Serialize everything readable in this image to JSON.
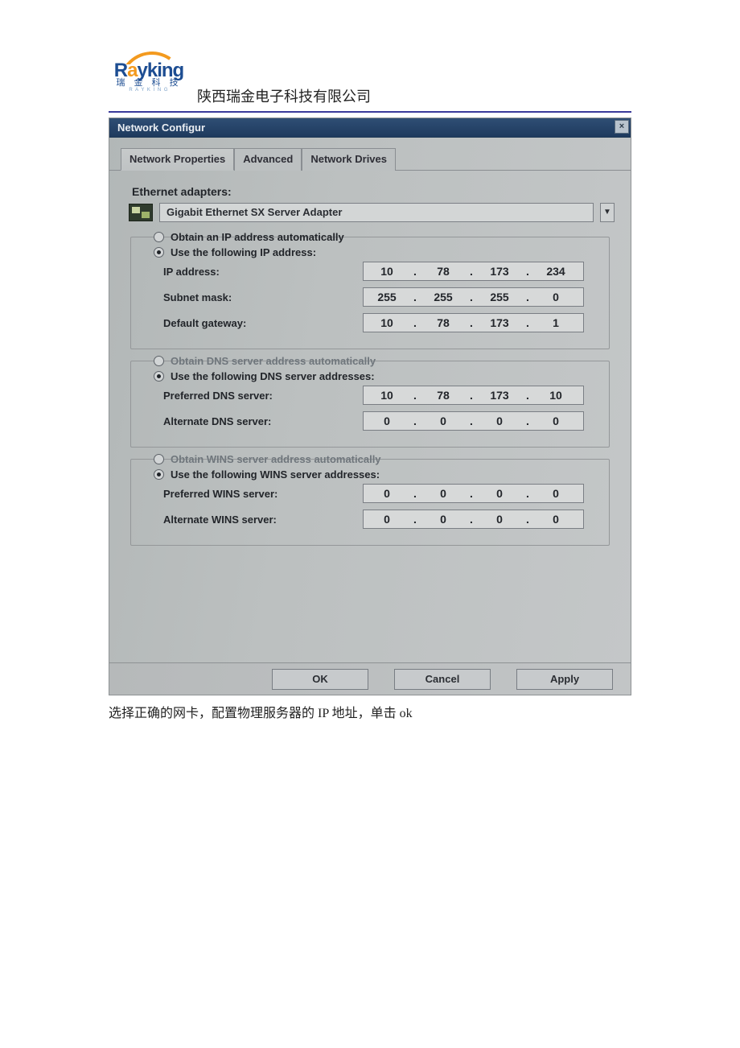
{
  "header": {
    "logo_main_a": "R",
    "logo_main_o": "a",
    "logo_main_b": "yking",
    "logo_sub": "瑞 金 科 技",
    "logo_tiny": "R A Y K I N G",
    "company": "陕西瑞金电子科技有限公司"
  },
  "dialog": {
    "title": "Network Configur",
    "tabs": [
      "Network Properties",
      "Advanced",
      "Network Drives"
    ],
    "adapters_label": "Ethernet adapters:",
    "adapter_selected": "Gigabit Ethernet SX Server Adapter",
    "ip_section": {
      "auto_label": "Obtain an IP address automatically",
      "manual_label": "Use the following IP address:",
      "selected": "manual",
      "fields": {
        "ip": {
          "label": "IP address:",
          "value": [
            "10",
            "78",
            "173",
            "234"
          ]
        },
        "mask": {
          "label": "Subnet mask:",
          "value": [
            "255",
            "255",
            "255",
            "0"
          ]
        },
        "gateway": {
          "label": "Default gateway:",
          "value": [
            "10",
            "78",
            "173",
            "1"
          ]
        }
      }
    },
    "dns_section": {
      "auto_label": "Obtain DNS server address automatically",
      "manual_label": "Use the following DNS server addresses:",
      "selected": "manual",
      "auto_enabled": false,
      "fields": {
        "pref": {
          "label": "Preferred DNS server:",
          "value": [
            "10",
            "78",
            "173",
            "10"
          ]
        },
        "alt": {
          "label": "Alternate DNS server:",
          "value": [
            "0",
            "0",
            "0",
            "0"
          ]
        }
      }
    },
    "wins_section": {
      "auto_label": "Obtain WINS server address automatically",
      "manual_label": "Use the following WINS server addresses:",
      "selected": "manual",
      "auto_enabled": false,
      "fields": {
        "pref": {
          "label": "Preferred WINS server:",
          "value": [
            "0",
            "0",
            "0",
            "0"
          ]
        },
        "alt": {
          "label": "Alternate WINS server:",
          "value": [
            "0",
            "0",
            "0",
            "0"
          ]
        }
      }
    },
    "buttons": {
      "ok": "OK",
      "cancel": "Cancel",
      "apply": "Apply"
    }
  },
  "caption": "选择正确的网卡，配置物理服务器的 IP 地址，单击 ok"
}
